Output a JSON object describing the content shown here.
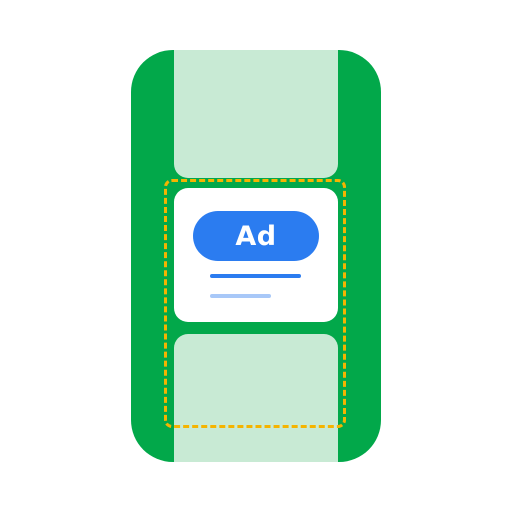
{
  "illustration": {
    "ad_label": "Ad",
    "colors": {
      "phone_frame": "#02a84a",
      "content_placeholder": "#c8ead4",
      "dashed_outline": "#f5b400",
      "ad_accent": "#2b7cf0",
      "ad_secondary_line": "#a8c8f8",
      "card_background": "#ffffff"
    }
  }
}
